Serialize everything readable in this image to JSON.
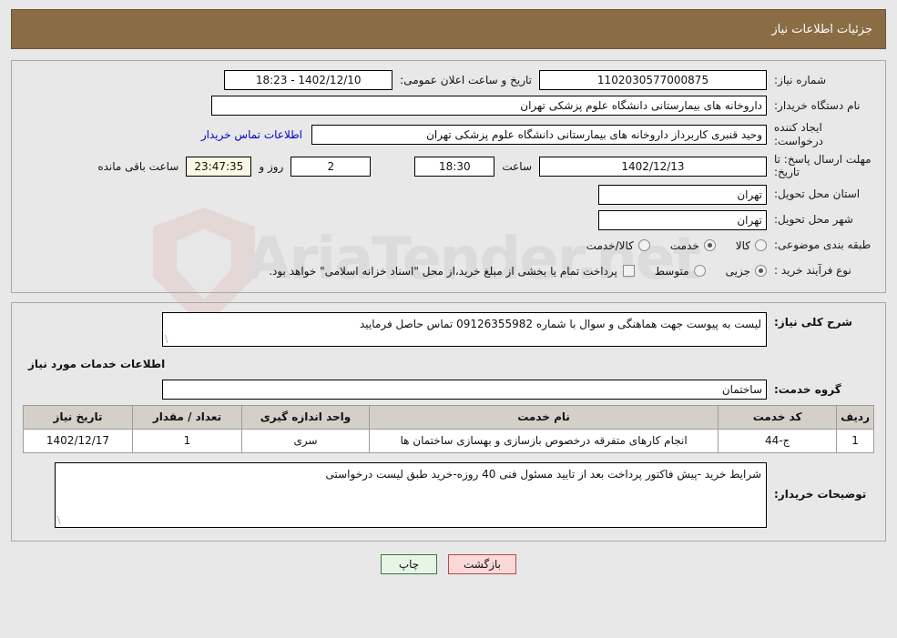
{
  "header": {
    "title": "جزئیات اطلاعات نیاز",
    "bg_color": "#8a6d44"
  },
  "watermark": {
    "text": "AriaTender.net"
  },
  "info": {
    "need_number_label": "شماره نیاز:",
    "need_number_value": "1102030577000875",
    "announce_label": "تاریخ و ساعت اعلان عمومی:",
    "announce_value": "18:23 - 1402/12/10",
    "buyer_org_label": "نام دستگاه خریدار:",
    "buyer_org_value": "داروخانه های بیمارستانی دانشگاه علوم پزشکی تهران",
    "requester_label": "ایجاد کننده درخواست:",
    "requester_value": "وحید قنبری کاربرداز داروخانه های بیمارستانی دانشگاه علوم پزشکی تهران",
    "contact_link": "اطلاعات تماس خریدار",
    "deadline_label": "مهلت ارسال پاسخ: تا تاریخ:",
    "deadline_date": "1402/12/13",
    "hour_label": "ساعت",
    "deadline_time": "18:30",
    "days_remaining": "2",
    "days_label": "روز و",
    "timer": "23:47:35",
    "timer_label": "ساعت باقی مانده",
    "province_label": "استان محل تحویل:",
    "province_value": "تهران",
    "city_label": "شهر محل تحویل:",
    "city_value": "تهران",
    "category_label": "طبقه بندی موضوعی:",
    "category_options": [
      {
        "label": "کالا",
        "checked": false
      },
      {
        "label": "خدمت",
        "checked": true
      },
      {
        "label": "کالا/خدمت",
        "checked": false
      }
    ],
    "process_label": "نوع فرآیند خرید :",
    "process_options": [
      {
        "label": "جزیی",
        "checked": true
      },
      {
        "label": "متوسط",
        "checked": false
      }
    ],
    "treasury_note": "پرداخت تمام یا بخشی از مبلغ خرید،از محل \"اسناد خزانه اسلامی\" خواهد بود."
  },
  "description": {
    "label": "شرح کلی نیاز:",
    "value": "لیست به پیوست جهت هماهنگی و سوال با شماره 09126355982 تماس حاصل فرمایید"
  },
  "services": {
    "section_title": "اطلاعات خدمات مورد نیاز",
    "group_label": "گروه خدمت:",
    "group_value": "ساختمان",
    "table": {
      "columns": [
        "ردیف",
        "کد خدمت",
        "نام خدمت",
        "واحد اندازه گیری",
        "تعداد / مقدار",
        "تاریخ نیاز"
      ],
      "rows": [
        {
          "index": "1",
          "code": "ج-44",
          "name": "انجام کارهای متفرقه درخصوص بازسازی و بهسازی ساختمان ها",
          "unit": "سری",
          "quantity": "1",
          "need_date": "1402/12/17"
        }
      ]
    }
  },
  "buyer_notes": {
    "label": "توضیحات خریدار:",
    "value": "شرایط خرید -پیش فاکتور پرداخت بعد از تایید مسئول فنی 40 روزه-خرید طبق لیست درخواستی"
  },
  "footer": {
    "print_label": "چاپ",
    "back_label": "بازگشت",
    "print_color": "#e6f5e6",
    "back_color": "#fbd9d9"
  }
}
